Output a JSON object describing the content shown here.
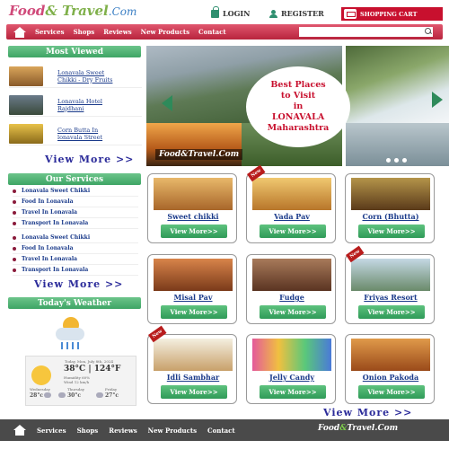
{
  "header": {
    "logo_main": "Food",
    "logo_amp": "& Travel",
    "logo_suffix": ".Com",
    "login_label": "LOGIN",
    "register_label": "REGISTER",
    "cart_label": "SHOPPING CART"
  },
  "nav": {
    "items": [
      "Services",
      "Shops",
      "Reviews",
      "New Products",
      "Contact"
    ]
  },
  "most_viewed": {
    "title": "Most Viewed",
    "items": [
      {
        "label_line1": "Lonavala Sweet",
        "label_line2": "Chikki - Dry Fruits"
      },
      {
        "label_line1": "Lonavala Hotel",
        "label_line2": "Rajdhani"
      },
      {
        "label_line1": "Corn Butta In",
        "label_line2": "lonavala Street"
      }
    ],
    "view_more": "View More >>"
  },
  "services": {
    "title": "Our Services",
    "items": [
      "Lonavala Sweet Chikki",
      "Food In Lonavala",
      "Travel In Lonavala",
      "Transport In Lonavala",
      "Lonavala Sweet Chikki",
      "Food In Lonavala",
      "Travel In Lonavala",
      "Transport In Lonavala"
    ],
    "view_more": "View More >>"
  },
  "slider": {
    "promo_line1": "Best Places",
    "promo_line2": "to Visit",
    "promo_line3": "in",
    "promo_line4": "LONAVALA",
    "promo_line5": "Maharashtra",
    "logo": "Food&Travel.Com"
  },
  "products": {
    "button_label": "View More>>",
    "new_badge": "New",
    "items": [
      {
        "title": "Sweet chikki",
        "is_new": false,
        "color": "#c98a3e"
      },
      {
        "title": "Vada Pav",
        "is_new": true,
        "color": "#d9a048"
      },
      {
        "title": "Corn (Bhutta)",
        "is_new": false,
        "color": "#8a6a2a"
      },
      {
        "title": "Misal Pav",
        "is_new": false,
        "color": "#a35a1f"
      },
      {
        "title": "Fudge",
        "is_new": false,
        "color": "#7a4a2a"
      },
      {
        "title": "Friyas Resort",
        "is_new": true,
        "color": "#8aa7b8"
      },
      {
        "title": "Idli Sambhar",
        "is_new": true,
        "color": "#e5dfcc"
      },
      {
        "title": "Jelly Candy",
        "is_new": false,
        "color": "#c85a9a"
      },
      {
        "title": "Onion Pakoda",
        "is_new": false,
        "color": "#c8742a"
      }
    ],
    "view_more": "View More >>"
  },
  "weather": {
    "title": "Today's Weather",
    "day_label": "Today, Mon, July 8th, 2024",
    "temp": "38°C | 124°F",
    "desc_line1": "Humidity 60%",
    "desc_line2": "Wind 12 km/h",
    "forecast": [
      {
        "day": "Wednesday",
        "temp": "28°c"
      },
      {
        "day": "Thursday",
        "temp": "30°c"
      },
      {
        "day": "Friday",
        "temp": "27°c"
      }
    ]
  },
  "footer": {
    "items": [
      "Services",
      "Shops",
      "Reviews",
      "New Products",
      "Contact"
    ],
    "logo_main": "Food",
    "logo_amp": "&",
    "logo_rest": "Travel.Com"
  }
}
